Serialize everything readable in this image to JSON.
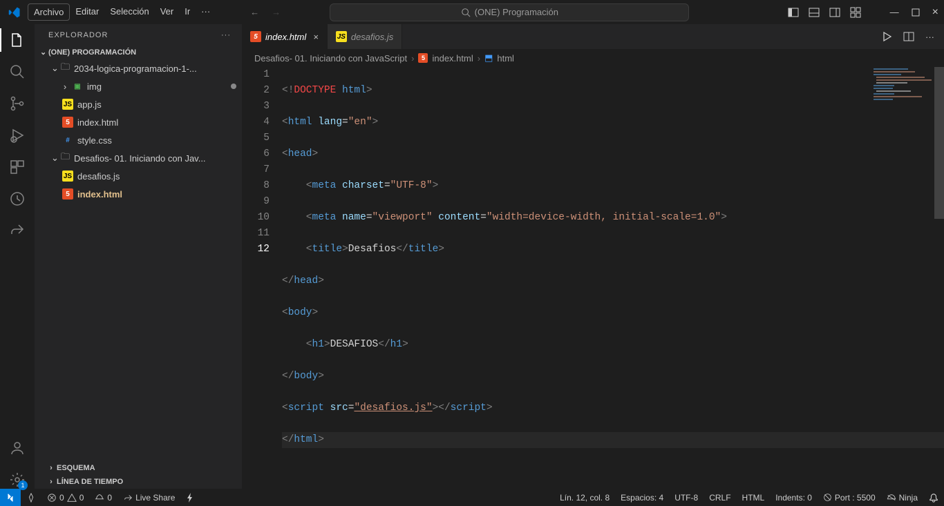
{
  "title_menu": {
    "items": [
      "Archivo",
      "Editar",
      "Selección",
      "Ver",
      "Ir"
    ],
    "more": "···"
  },
  "search": {
    "placeholder": "(ONE) Programación"
  },
  "sidebar": {
    "title": "EXPLORADOR",
    "root": "(ONE) PROGRAMACIÓN",
    "folder1": "2034-logica-programacion-1-...",
    "items": {
      "img": "img",
      "appjs": "app.js",
      "indexhtml1": "index.html",
      "stylecss": "style.css"
    },
    "folder2": "Desafios- 01. Iniciando con Jav...",
    "items2": {
      "desafiosjs": "desafios.js",
      "indexhtml2": "index.html"
    },
    "outline": "ESQUEMA",
    "timeline": "LÍNEA DE TIEMPO"
  },
  "tabs": {
    "t1": "index.html",
    "t2": "desafios.js"
  },
  "breadcrumb": {
    "p1": "Desafios- 01. Iniciando con JavaScript",
    "p2": "index.html",
    "p3": "html"
  },
  "code": {
    "l1a": "<!",
    "l1b": "DOCTYPE",
    "l1c": " html",
    "l1d": ">",
    "l2a": "<",
    "l2b": "html",
    "l2c": " lang",
    "l2d": "=",
    "l2e": "\"en\"",
    "l2f": ">",
    "l3a": "<",
    "l3b": "head",
    "l3c": ">",
    "l4a": "    <",
    "l4b": "meta",
    "l4c": " charset",
    "l4d": "=",
    "l4e": "\"UTF-8\"",
    "l4f": ">",
    "l5a": "    <",
    "l5b": "meta",
    "l5c": " name",
    "l5d": "=",
    "l5e": "\"viewport\"",
    "l5f": " content",
    "l5g": "=",
    "l5h": "\"width=device-width, initial-scale=1.0\"",
    "l5i": ">",
    "l6a": "    <",
    "l6b": "title",
    "l6c": ">",
    "l6d": "Desafios",
    "l6e": "</",
    "l6f": "title",
    "l6g": ">",
    "l7a": "</",
    "l7b": "head",
    "l7c": ">",
    "l8a": "<",
    "l8b": "body",
    "l8c": ">",
    "l9a": "    <",
    "l9b": "h1",
    "l9c": ">",
    "l9d": "DESAFIOS",
    "l9e": "</",
    "l9f": "h1",
    "l9g": ">",
    "l10a": "</",
    "l10b": "body",
    "l10c": ">",
    "l11a": "<",
    "l11b": "script",
    "l11c": " src",
    "l11d": "=",
    "l11e": "\"desafios.js\"",
    "l11f": ">",
    "l11g": "</",
    "l11h": "script",
    "l11i": ">",
    "l12a": "</",
    "l12b": "html",
    "l12c": ">"
  },
  "line_numbers": [
    "1",
    "2",
    "3",
    "4",
    "5",
    "6",
    "7",
    "8",
    "9",
    "10",
    "11",
    "12"
  ],
  "status": {
    "errors": "0",
    "warnings": "0",
    "ports": "0",
    "liveshare": "Live Share",
    "pos": "Lín. 12, col. 8",
    "spaces": "Espacios: 4",
    "enc": "UTF-8",
    "eol": "CRLF",
    "lang": "HTML",
    "indents": "Indents: 0",
    "port": "Port : 5500",
    "ninja": "Ninja"
  },
  "activity": {
    "settings_badge": "1"
  }
}
